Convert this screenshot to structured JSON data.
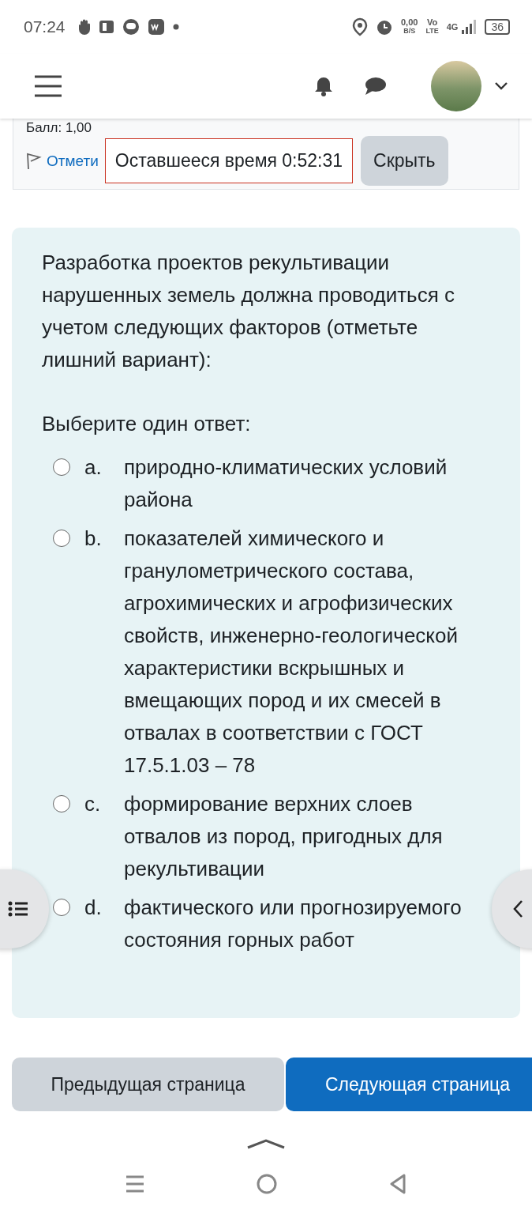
{
  "status_bar": {
    "time": "07:24",
    "data_rate": "0,00",
    "data_unit": "B/S",
    "volte_top": "Vo",
    "volte_bottom": "LTE",
    "network": "4G",
    "battery": "36"
  },
  "question_info": {
    "grade": "Балл: 1,00",
    "flag_link": "Отмети",
    "timer": "Оставшееся время 0:52:31",
    "hide_button": "Скрыть"
  },
  "question": {
    "text": "Разработка проектов рекультивации нарушенных земель должна проводиться с учетом следующих факторов (отметьте лишний вариант):",
    "prompt": "Выберите один ответ:",
    "options": [
      {
        "letter": "a.",
        "text": "природно-климатических условий района",
        "selected": false
      },
      {
        "letter": "b.",
        "text": "показателей химического и гранулометрического состава, агрохимических и агрофизических свойств, инженерно-геологической характеристики вскрышных и вмещающих пород и их смесей в отвалах в соответствии с ГОСТ 17.5.1.03 – 78",
        "selected": false
      },
      {
        "letter": "c.",
        "text": "формирование верхних слоев отвалов из пород, пригодных для рекультивации",
        "selected": false
      },
      {
        "letter": "d.",
        "text": "фактического или прогнозируемого состояния горных работ",
        "selected": false
      }
    ]
  },
  "navigation": {
    "previous": "Предыдущая страница",
    "next": "Следующая страница"
  }
}
